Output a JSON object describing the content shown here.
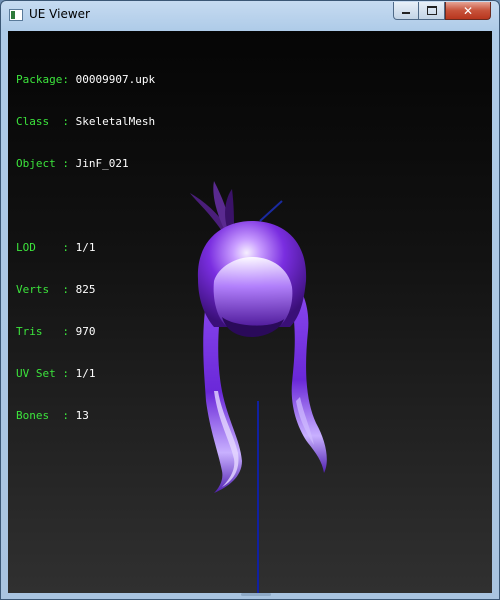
{
  "window": {
    "title": "UE Viewer",
    "icon": "app-icon",
    "controls": {
      "minimize_icon": "minimize-icon",
      "maximize_icon": "maximize-icon",
      "close_glyph": "✕"
    }
  },
  "info": {
    "package": {
      "key": "Package:",
      "value": "00009907.upk"
    },
    "class": {
      "key": "Class  :",
      "value": "SkeletalMesh"
    },
    "object": {
      "key": "Object :",
      "value": "JinF_021"
    },
    "lod": {
      "key": "LOD    :",
      "value": "1/1"
    },
    "verts": {
      "key": "Verts  :",
      "value": "825"
    },
    "tris": {
      "key": "Tris   :",
      "value": "970"
    },
    "uvset": {
      "key": "UV Set :",
      "value": "1/1"
    },
    "bones": {
      "key": "Bones  :",
      "value": "13"
    }
  },
  "colors": {
    "label_green": "#3ce43c",
    "value_white": "#ffffff",
    "hair_purple": "#7a2ee0",
    "hair_highlight": "#e6d8ff",
    "axis_blue": "#1020a0"
  },
  "scene": {
    "model": "purple-hair-mesh"
  }
}
